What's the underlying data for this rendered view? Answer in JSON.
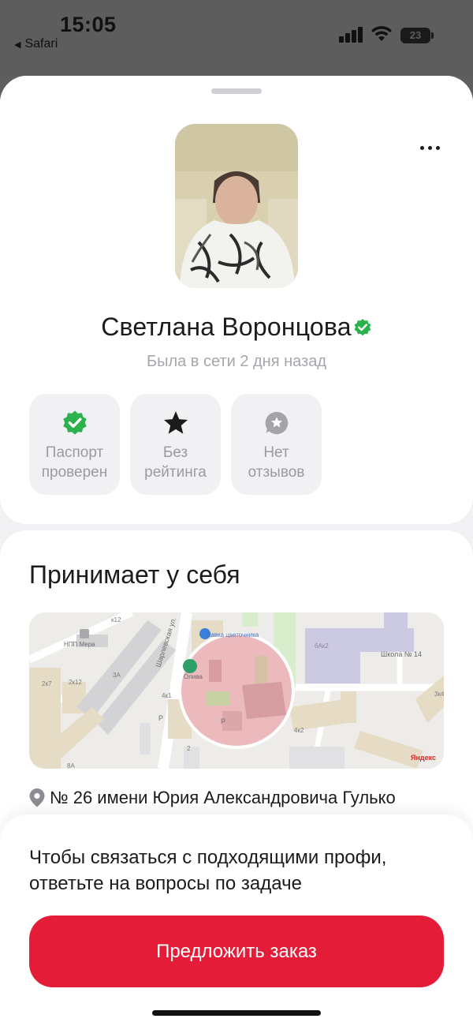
{
  "status_bar": {
    "time": "15:05",
    "back_app": "Safari",
    "battery_level": "23",
    "icons": [
      "cellular-signal-icon",
      "wifi-icon",
      "battery-icon"
    ]
  },
  "profile": {
    "name": "Светлана Воронцова",
    "verified": true,
    "last_seen": "Была в сети 2 дня назад",
    "badges": [
      {
        "icon": "check-badge-icon",
        "label": "Паспорт\nпроверен"
      },
      {
        "icon": "star-icon",
        "label": "Без\nрейтинга"
      },
      {
        "icon": "review-icon",
        "label": "Нет\nотзывов"
      }
    ]
  },
  "location": {
    "title": "Принимает у себя",
    "address": "№ 26 имени Юрия Александровича Гулько",
    "map": {
      "labels": [
        "НПП Мера",
        "Школа № 14",
        "Олива",
        "6Ак2",
        "2к7",
        "2к12",
        "3А",
        "4к1",
        "4к2",
        "3к4",
        "2",
        "8А",
        "к12",
        "Шарлевская ул.",
        "P",
        "Лавка цветочника"
      ],
      "attribution": "Яндекс"
    }
  },
  "cta": {
    "text": "Чтобы связаться с подходящими профи, ответьте на вопросы по задаче",
    "button_label": "Предложить заказ"
  },
  "colors": {
    "accent": "#e51c37",
    "verified": "#2bb24c",
    "muted_text": "#a6a6ac"
  }
}
